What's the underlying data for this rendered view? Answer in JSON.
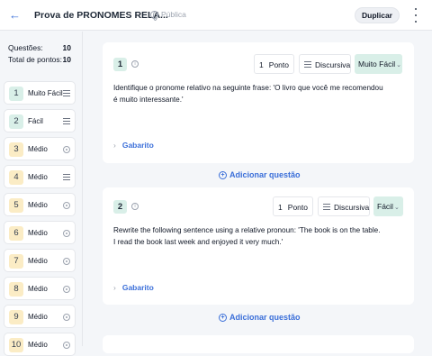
{
  "header": {
    "back_icon": "arrow-left-icon",
    "title": "Prova de PRONOMES RELA...",
    "visibility": "Pública",
    "duplicate_label": "Duplicar",
    "more_icon": "kebab-menu-icon"
  },
  "sidebar": {
    "questions_label": "Questões:",
    "questions_value": "10",
    "points_label": "Total de pontos:",
    "points_value": "10",
    "items": [
      {
        "num": "1",
        "label": "Muito Fácil",
        "icon": "lines-icon",
        "level": "easy"
      },
      {
        "num": "2",
        "label": "Fácil",
        "icon": "lines-icon",
        "level": "easy"
      },
      {
        "num": "3",
        "label": "Médio",
        "icon": "radio-icon",
        "level": "mid"
      },
      {
        "num": "4",
        "label": "Médio",
        "icon": "lines-icon",
        "level": "mid"
      },
      {
        "num": "5",
        "label": "Médio",
        "icon": "radio-icon",
        "level": "mid"
      },
      {
        "num": "6",
        "label": "Médio",
        "icon": "radio-icon",
        "level": "mid"
      },
      {
        "num": "7",
        "label": "Médio",
        "icon": "radio-icon",
        "level": "mid"
      },
      {
        "num": "8",
        "label": "Médio",
        "icon": "radio-icon",
        "level": "mid"
      },
      {
        "num": "9",
        "label": "Médio",
        "icon": "radio-icon",
        "level": "mid"
      },
      {
        "num": "10",
        "label": "Médio",
        "icon": "radio-icon",
        "level": "mid"
      }
    ]
  },
  "questions": [
    {
      "num": "1",
      "points_value": "1",
      "points_unit": "Ponto",
      "type": "Discursiva",
      "difficulty": "Muito Fácil",
      "text": "Identifique o pronome relativo na seguinte frase: 'O livro que você me recomendou é muito interessante.'",
      "answer_label": "Gabarito"
    },
    {
      "num": "2",
      "points_value": "1",
      "points_unit": "Ponto",
      "type": "Discursiva",
      "difficulty": "Fácil",
      "text": "Rewrite the following sentence using a relative pronoun: 'The book is on the table. I read the book last week and enjoyed it very much.'",
      "answer_label": "Gabarito"
    }
  ],
  "add_question_label": "Adicionar questão",
  "colors": {
    "accent": "#3b6fd9",
    "easy_badge": "#d9efe8",
    "medium_badge": "#fbecc5"
  }
}
